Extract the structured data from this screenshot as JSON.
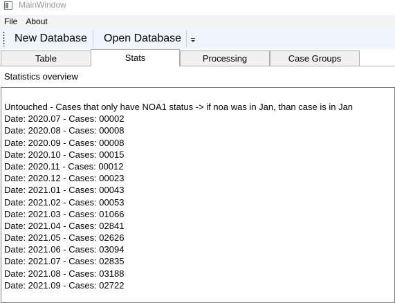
{
  "window": {
    "title": "MainWindow"
  },
  "menu": {
    "items": [
      {
        "label": "File"
      },
      {
        "label": "About"
      }
    ]
  },
  "toolbar": {
    "new_database_label": "New Database",
    "open_database_label": "Open Database",
    "overflow_glyph": "⩡"
  },
  "tabs": [
    {
      "label": "Table",
      "selected": false
    },
    {
      "label": "Stats",
      "selected": true
    },
    {
      "label": "Processing",
      "selected": false
    },
    {
      "label": "Case Groups",
      "selected": false
    }
  ],
  "stats": {
    "section_label": "Statistics overview",
    "lines": [
      "Untouched - Cases that only have NOA1 status -> if noa was in Jan, than case is in Jan",
      "Date: 2020.07 - Cases: 00002",
      "Date: 2020.08 - Cases: 00008",
      "Date: 2020.09 - Cases: 00008",
      "Date: 2020.10 - Cases: 00015",
      "Date: 2020.11 - Cases: 00012",
      "Date: 2020.12 - Cases: 00023",
      "Date: 2021.01 - Cases: 00043",
      "Date: 2021.02 - Cases: 00053",
      "Date: 2021.03 - Cases: 01066",
      "Date: 2021.04 - Cases: 02841",
      "Date: 2021.05 - Cases: 02626",
      "Date: 2021.06 - Cases: 03094",
      "Date: 2021.07 - Cases: 02835",
      "Date: 2021.08 - Cases: 03188",
      "Date: 2021.09 - Cases: 02722"
    ]
  }
}
